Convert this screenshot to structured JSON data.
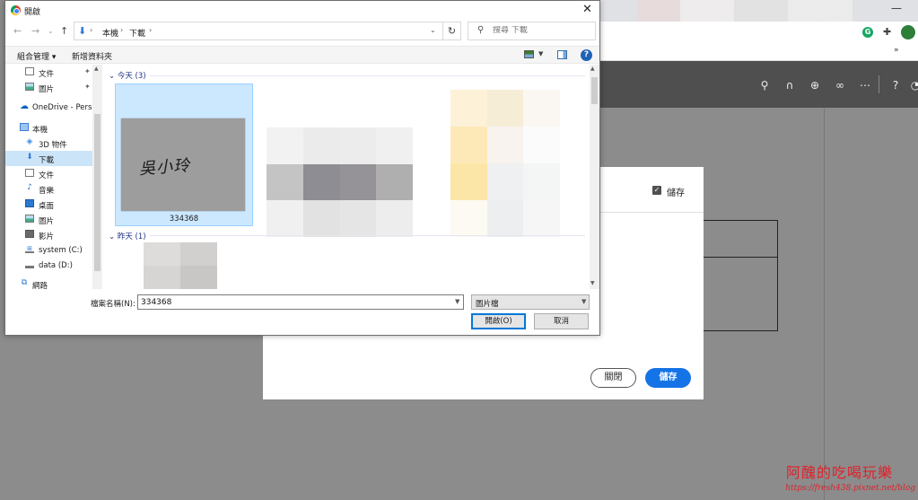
{
  "dialog": {
    "title": "開啟",
    "close_glyph": "✕",
    "address": {
      "segments": [
        "本機",
        "下載"
      ]
    },
    "search": {
      "placeholder": "搜尋 下載"
    },
    "commands": {
      "organize": "組合管理 ▾",
      "new_folder": "新增資料夾",
      "help": "?"
    },
    "nav": {
      "items": [
        {
          "label": "文件",
          "icon": "document-icon",
          "pinned": true
        },
        {
          "label": "圖片",
          "icon": "pictures-icon",
          "pinned": true
        },
        {
          "label": "OneDrive - Perso",
          "icon": "onedrive-icon"
        },
        {
          "label": "本機",
          "icon": "this-pc-icon"
        },
        {
          "label": "3D 物件",
          "icon": "3d-objects-icon"
        },
        {
          "label": "下載",
          "icon": "download-icon",
          "selected": true
        },
        {
          "label": "文件",
          "icon": "document-icon"
        },
        {
          "label": "音樂",
          "icon": "music-icon"
        },
        {
          "label": "桌面",
          "icon": "desktop-icon"
        },
        {
          "label": "圖片",
          "icon": "pictures-icon"
        },
        {
          "label": "影片",
          "icon": "video-icon"
        },
        {
          "label": "system (C:)",
          "icon": "drive-c-icon"
        },
        {
          "label": "data (D:)",
          "icon": "drive-d-icon"
        },
        {
          "label": "網路",
          "icon": "network-icon"
        }
      ]
    },
    "groups": [
      {
        "label": "今天 (3)"
      },
      {
        "label": "昨天 (1)"
      }
    ],
    "selected_file": {
      "name": "334368",
      "signature_text": "吳小玲"
    },
    "filename_label": "檔案名稱(N):",
    "filename_value": "334368",
    "filetype": "圖片檔",
    "open_button": "開啟(O)",
    "cancel_button": "取消"
  },
  "background": {
    "save_checkbox_label": "儲存",
    "close_button": "關閉",
    "save_button": "儲存",
    "accent_color": "#1473e6"
  },
  "watermark": {
    "title": "阿醜的吃喝玩樂",
    "url": "https://fresh438.pixnet.net/blog"
  }
}
